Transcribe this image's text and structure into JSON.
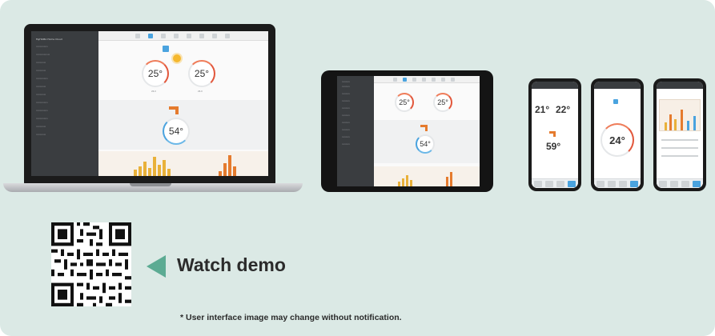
{
  "cta": {
    "label": "Watch demo",
    "qr_icon": "qr-code-icon",
    "arrow_icon": "play-triangle-icon"
  },
  "disclaimer": "* User interface image may change without notification.",
  "colors": {
    "panel_bg": "#dbe9e5",
    "accent": "#5cab93",
    "app_sidebar": "#3a3d40",
    "app_blue": "#4aa3df",
    "heat_orange": "#e57b2e"
  },
  "devices": {
    "laptop": {
      "sidebar_title": "MyHAMA Home Cloud",
      "zones": [
        {
          "temp": "25°",
          "sub": "26.0"
        },
        {
          "temp": "25°",
          "sub": "26.0"
        }
      ],
      "water_temp": "54°"
    },
    "tablet": {
      "zones": [
        {
          "temp": "25°"
        },
        {
          "temp": "25°"
        }
      ],
      "water_temp": "54°"
    },
    "phones": [
      {
        "zone1": "21°",
        "zone2": "22°",
        "water": "59°"
      },
      {
        "temp": "24°"
      },
      {
        "view": "energy chart"
      }
    ]
  }
}
